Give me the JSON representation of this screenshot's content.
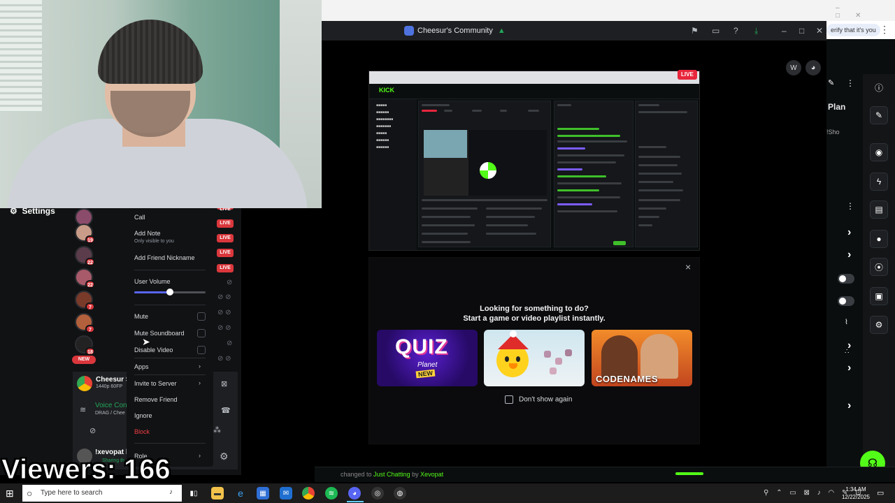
{
  "webcam_overlay": {
    "viewers_text": "Viewers: 166"
  },
  "popout": {
    "title": "Cheesur's Community",
    "title_suffix": "▲",
    "avatar_w": "W",
    "shared_screen_live_badge": "LIVE",
    "shared_screen_logo": "KICK"
  },
  "activity_prompt": {
    "heading_line1": "Looking for something to do?",
    "heading_line2": "Start a game or video playlist instantly.",
    "games": [
      {
        "title": "QUIZ",
        "subtitle": "Planet",
        "badge": "NEW"
      },
      {
        "title": ""
      },
      {
        "title": "CODENAMES ONLINE"
      }
    ],
    "dont_show_label": "Don't show again",
    "close_icon": "×"
  },
  "browser": {
    "verify_text": "erify that it's you"
  },
  "kick_side": {
    "plan_text": "Plan",
    "show_label": "!Sho"
  },
  "kick_strip": {
    "text_prefix": "changed to ",
    "category": "Just Chatting",
    "text_mid": " by ",
    "user": "Xevopat"
  },
  "discord_left": {
    "settings_label": "Settings",
    "live_tags": [
      "LIVE",
      "LIVE",
      "LIVE",
      "LIVE",
      "LIVE"
    ],
    "avatar_counts": [
      "19",
      "22",
      "22",
      "7",
      "7",
      "18"
    ],
    "new_tag": "NEW",
    "voice_panel": {
      "stream_name": "Cheesur S",
      "stream_sub": "1440p 60FP",
      "voice_label": "Voice Con",
      "voice_sub": "DRAG / Chee",
      "user_name": "!xevopat l",
      "user_sub": "Sharing th"
    }
  },
  "context_menu": {
    "items": {
      "call": "Call",
      "add_note": "Add Note",
      "add_note_sub": "Only visible to you",
      "add_nickname": "Add Friend Nickname",
      "user_volume": "User Volume",
      "mute": "Mute",
      "mute_soundboard": "Mute Soundboard",
      "disable_video": "Disable Video",
      "apps": "Apps",
      "invite": "Invite to Server",
      "remove_friend": "Remove Friend",
      "ignore": "Ignore",
      "block": "Block",
      "role": "Role"
    },
    "user_volume_level": 0.5
  },
  "taskbar": {
    "search_placeholder": "Type here to search",
    "time": "1:34 AM",
    "date": "12/22/2025"
  },
  "colors": {
    "discord_bg": "#111214",
    "kick_green": "#53fc18",
    "live_red": "#da373c",
    "block_red": "#f23f43",
    "blurple": "#5865f2"
  }
}
